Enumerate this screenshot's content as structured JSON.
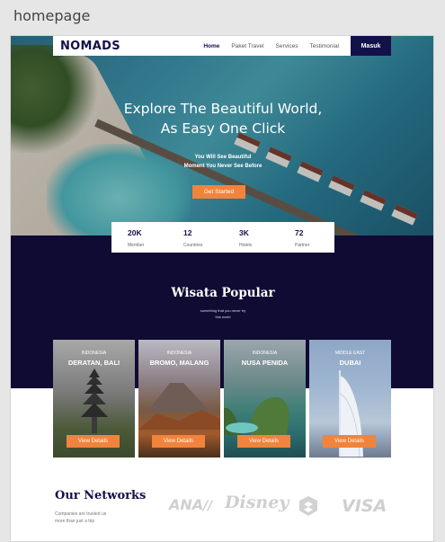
{
  "frame": {
    "label": "homepage"
  },
  "nav": {
    "logo": "NOMADS",
    "links": [
      "Home",
      "Paket Travel",
      "Services",
      "Testimonial"
    ],
    "login": "Masuk"
  },
  "hero": {
    "title_line1": "Explore The Beautiful World,",
    "title_line2": "As Easy One Click",
    "subtitle_line1": "You Will See Beautiful",
    "subtitle_line2": "Moment You Never See Before",
    "cta": "Get Started"
  },
  "stats": [
    {
      "value": "20K",
      "label": "Member"
    },
    {
      "value": "12",
      "label": "Countries"
    },
    {
      "value": "3K",
      "label": "Hotels"
    },
    {
      "value": "72",
      "label": "Partner"
    }
  ],
  "popular": {
    "title": "Wisata Popular",
    "subtitle_line1": "something that you never try",
    "subtitle_line2": "this world",
    "cards": [
      {
        "country": "INDONESIA",
        "place": "DERATAN, BALI",
        "button": "View Details"
      },
      {
        "country": "INDONESIA",
        "place": "BROMO, MALANG",
        "button": "View Details"
      },
      {
        "country": "INDONESIA",
        "place": "NUSA PENIDA",
        "button": "View Details"
      },
      {
        "country": "MIDDLE EAST",
        "place": "DUBAI",
        "button": "View Details"
      }
    ]
  },
  "networks": {
    "title": "Our Networks",
    "subtitle_line1": "Companies are trusted us",
    "subtitle_line2": "more than just a trip",
    "partners": [
      "ANA",
      "Disney",
      "VISA"
    ]
  },
  "colors": {
    "primary": "#13114a",
    "accent": "#f0843c",
    "dark_section": "#100b33"
  }
}
